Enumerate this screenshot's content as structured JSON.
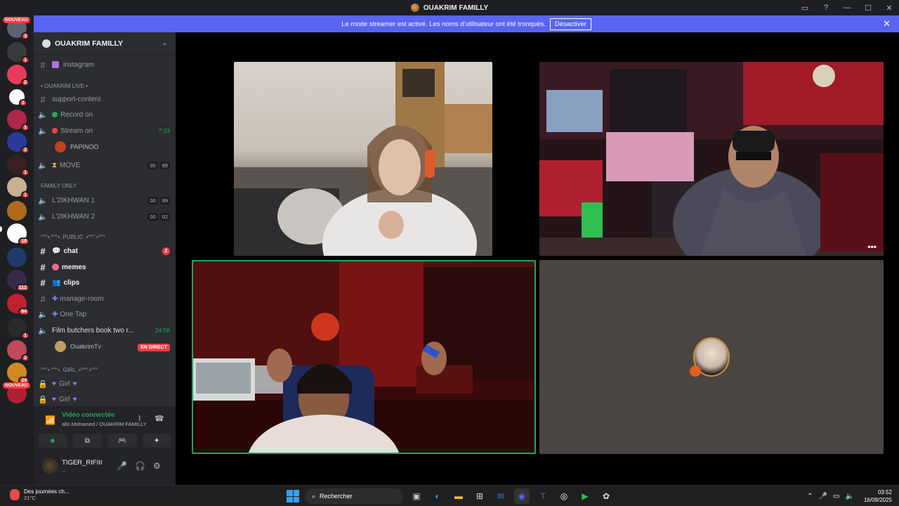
{
  "window": {
    "title": "OUAKRIM FAMILLY"
  },
  "banner": {
    "text": "Le mode streamer est activé. Les noms d'utilisateur ont été tronqués.",
    "button": "Désactiver"
  },
  "rail": {
    "new_top": "NOUVEAU",
    "new_bottom": "NOUVEAU",
    "badges": [
      "3",
      "1",
      "2",
      "1",
      "1",
      "2",
      "1",
      "1",
      "1",
      "1",
      "1",
      "18",
      "1",
      "112",
      "64",
      "1",
      "2",
      "24"
    ]
  },
  "sidebar": {
    "server_name": "OUAKRIM FAMILLY",
    "items": {
      "instagram": "instagram",
      "cat_live": "• OUAKRIM LIVE •",
      "support": "support-content",
      "record": "Record on",
      "stream": "Stream on",
      "stream_time": "7:33",
      "papinoo": "PAPINOO",
      "move": "MOVE",
      "move_tag1": "00",
      "move_tag2": "99",
      "cat_family": "FAMILY ONLY",
      "ikhwan1": "L'2IKHWAN 1",
      "ikhwan1_tag1": "00",
      "ikhwan1_tag2": "99",
      "ikhwan2": "L'2IKHWAN 2",
      "ikhwan2_tag1": "00",
      "ikhwan2_tag2": "02",
      "cat_public": "°°°•.°°°•. PUBLIC .•°°°.•°°°",
      "chat": "chat",
      "chat_unread": "2",
      "memes": "memes",
      "clips": "clips",
      "manage": "manage-room",
      "onetap": "One Tap",
      "film": "Film butchers book two r...",
      "film_time": "24:58",
      "ouakrimtv": "OuakrimTv",
      "live_badge": "EN DIRECT",
      "cat_girl": "°°°•.°°°•. Girl .•°°°.•°°°",
      "girl1": "Girl",
      "girl2": "Girl"
    }
  },
  "voice": {
    "status": "Vidéo connectée",
    "sub": "allo Mohamed / OUAKRIM FAMILLY"
  },
  "user": {
    "name": "TIGER_RIFIII",
    "sub": "..."
  },
  "taskbar": {
    "weather_title": "Des journées ch...",
    "weather_temp": "21°C",
    "search": "Rechercher",
    "time": "03:52",
    "date": "16/09/2025"
  }
}
